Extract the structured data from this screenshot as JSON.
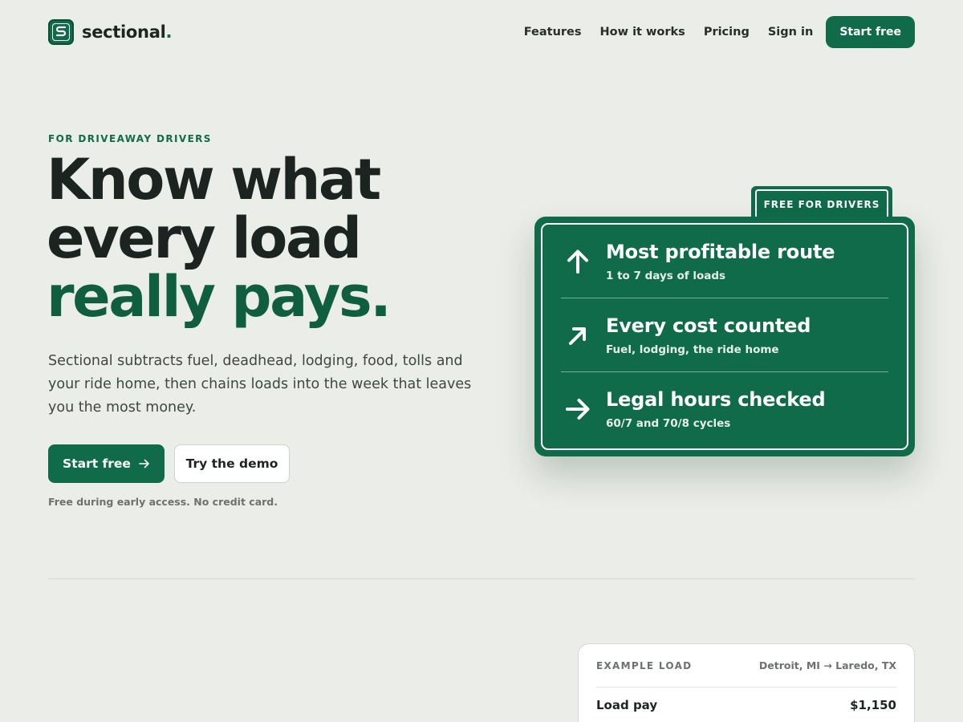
{
  "brand": {
    "name": "sectional",
    "dot": ".",
    "logo_letter": "S"
  },
  "nav": {
    "links": [
      "Features",
      "How it works",
      "Pricing",
      "Sign in"
    ],
    "cta": "Start free"
  },
  "hero": {
    "eyebrow": "FOR DRIVEAWAY DRIVERS",
    "headline_line1": "Know what",
    "headline_line2": "every load",
    "headline_accent": "really pays.",
    "lede": "Sectional subtracts fuel, deadhead, lodging, food, tolls and your ride home, then chains loads into the week that leaves you the most money.",
    "primary_cta": "Start free",
    "primary_cta_icon": "arrow-right-icon",
    "secondary_cta": "Try the demo",
    "fineprint": "Free during early access. No credit card."
  },
  "sign": {
    "tab": "FREE FOR DRIVERS",
    "rows": [
      {
        "icon": "arrow-up-icon",
        "title": "Most profitable route",
        "sub": "1 to 7 days of loads"
      },
      {
        "icon": "arrow-up-right-icon",
        "title": "Every cost counted",
        "sub": "Fuel, lodging, the ride home"
      },
      {
        "icon": "arrow-right-icon",
        "title": "Legal hours checked",
        "sub": "60/7 and 70/8 cycles"
      }
    ]
  },
  "example_card": {
    "label": "EXAMPLE LOAD",
    "route_from": "Detroit, MI",
    "route_arrow": "→",
    "route_to": "Laredo, TX",
    "rows": [
      {
        "label": "Load pay",
        "value": "$1,150"
      }
    ]
  },
  "colors": {
    "accent": "#0f6b4a",
    "accent_dark": "#0f5e40",
    "background": "#ebede8",
    "text": "#1c2621"
  }
}
